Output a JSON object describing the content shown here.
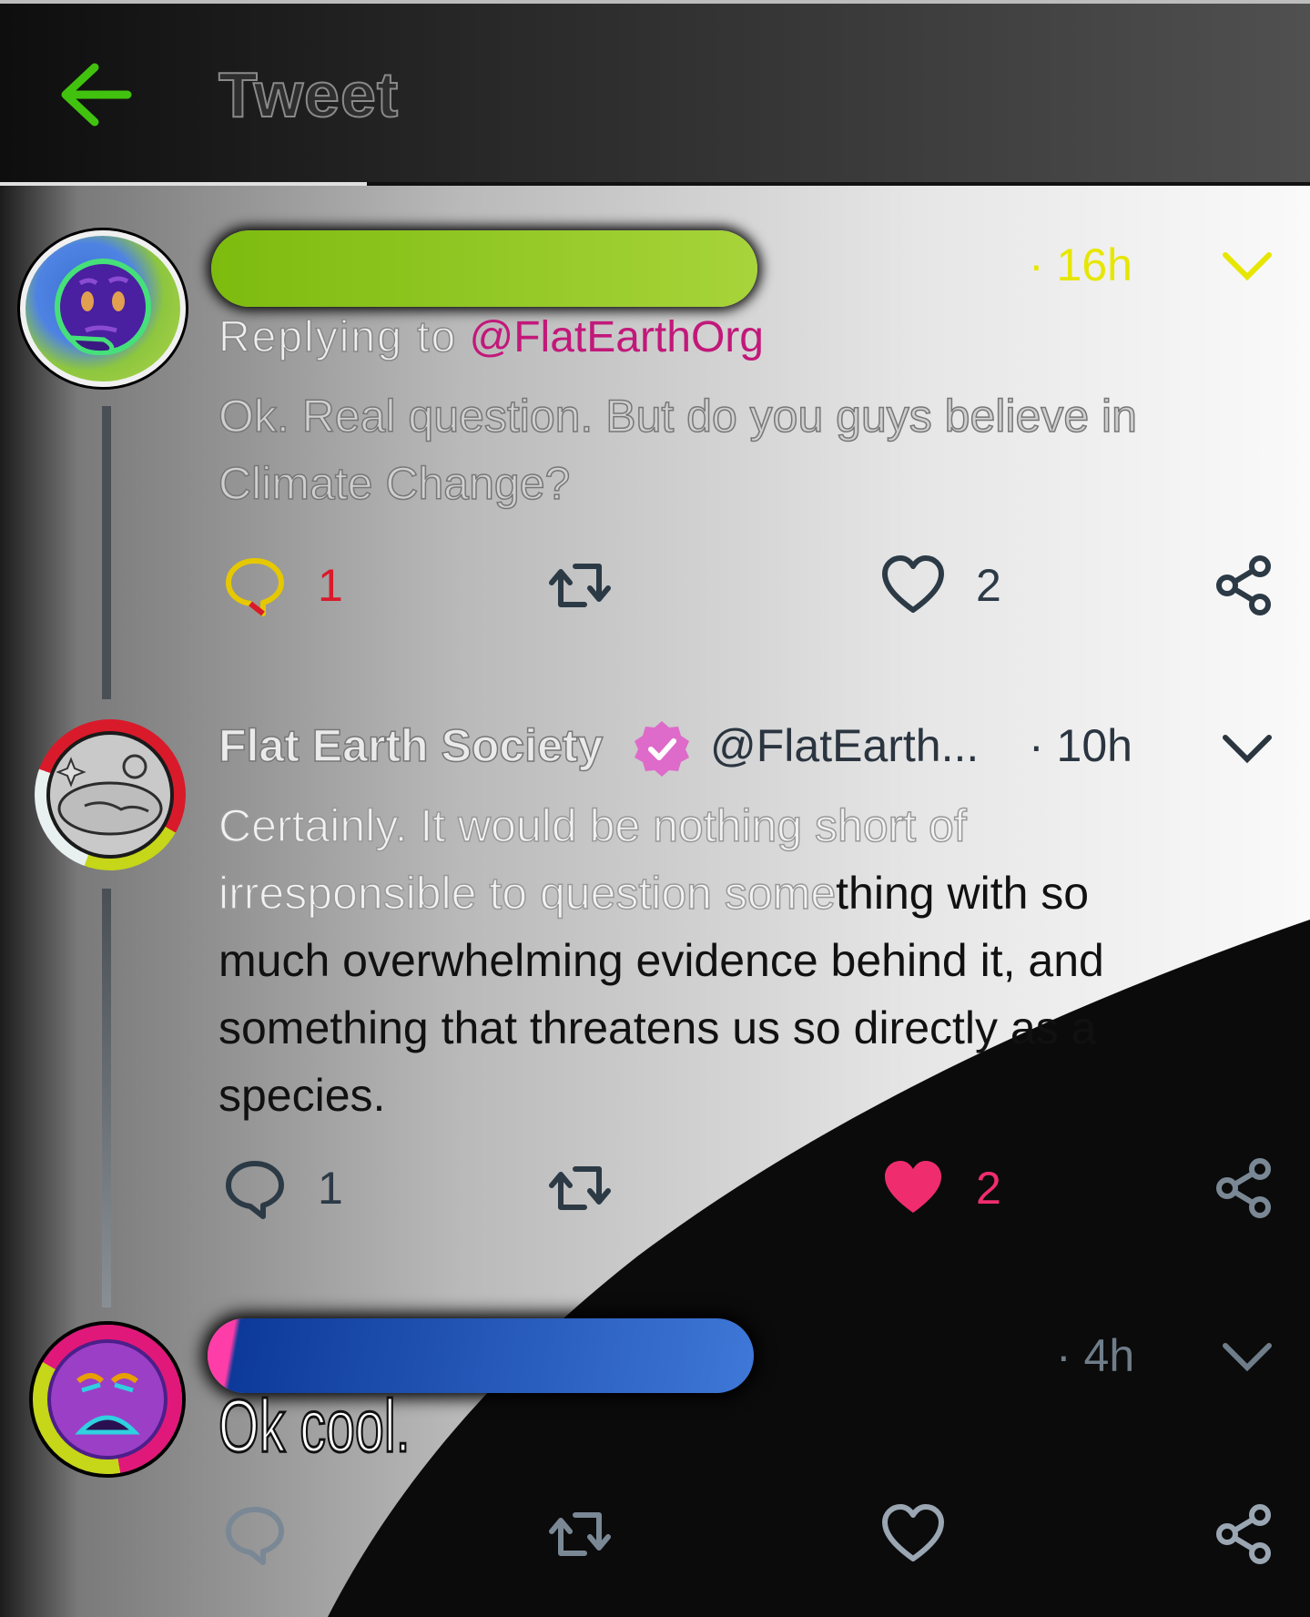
{
  "header": {
    "title": "Tweet",
    "back_icon": "arrow-left-icon",
    "accent": "#41c20f"
  },
  "tweets": [
    {
      "author_redacted": true,
      "time": "· 16h",
      "replying_label": "Replying to",
      "replying_handle": "@FlatEarthOrg",
      "text": "Ok. Real question. But do you guys believe in Climate Change?",
      "reply_count": "1",
      "retweet_count": "",
      "like_count": "2"
    },
    {
      "author_name": "Flat Earth Society",
      "verified": true,
      "handle": "@FlatEarth...",
      "time": "· 10h",
      "text_a": "Certainly. It would be nothing short of irresponsible to question some",
      "text_b": "thing with so much overwhelming evidence behind it, and something that threatens us so directly as a species.",
      "reply_count": "1",
      "retweet_count": "",
      "like_count": "2",
      "liked": true
    },
    {
      "author_redacted": true,
      "time": "· 4h",
      "text": "Ok cool.",
      "reply_count": "",
      "retweet_count": "",
      "like_count": ""
    }
  ],
  "colors": {
    "like": "#ef2d6e",
    "icon": "#2c3a46",
    "handle": "#c2187a"
  }
}
